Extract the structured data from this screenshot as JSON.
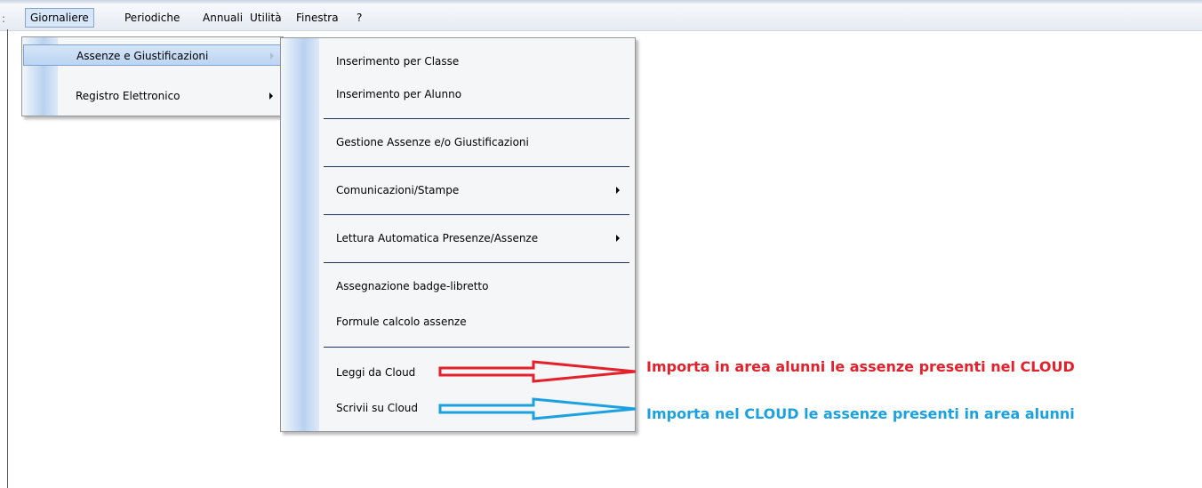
{
  "menubar": {
    "items": [
      "Giornaliere",
      "Periodiche",
      "Annuali",
      "Utilità",
      "Finestra",
      "?"
    ]
  },
  "giornaliere_menu": {
    "items": [
      "Assenze e Giustificazioni",
      "Registro Elettronico"
    ]
  },
  "assenze_menu": {
    "items": [
      "Inserimento per Classe",
      "Inserimento per Alunno",
      "Gestione Assenze e/o Giustificazioni",
      "Comunicazioni/Stampe",
      "Lettura Automatica Presenze/Assenze",
      "Assegnazione badge-libretto",
      "Formule calcolo assenze",
      "Leggi da Cloud",
      "Scrivii su Cloud"
    ]
  },
  "annotations": {
    "read_cloud": "Importa in area alunni le assenze presenti nel CLOUD",
    "write_cloud": "Importa nel CLOUD le assenze presenti in area alunni"
  },
  "colors": {
    "read_arrow": "#e4202a",
    "write_arrow": "#1ba1e2"
  }
}
